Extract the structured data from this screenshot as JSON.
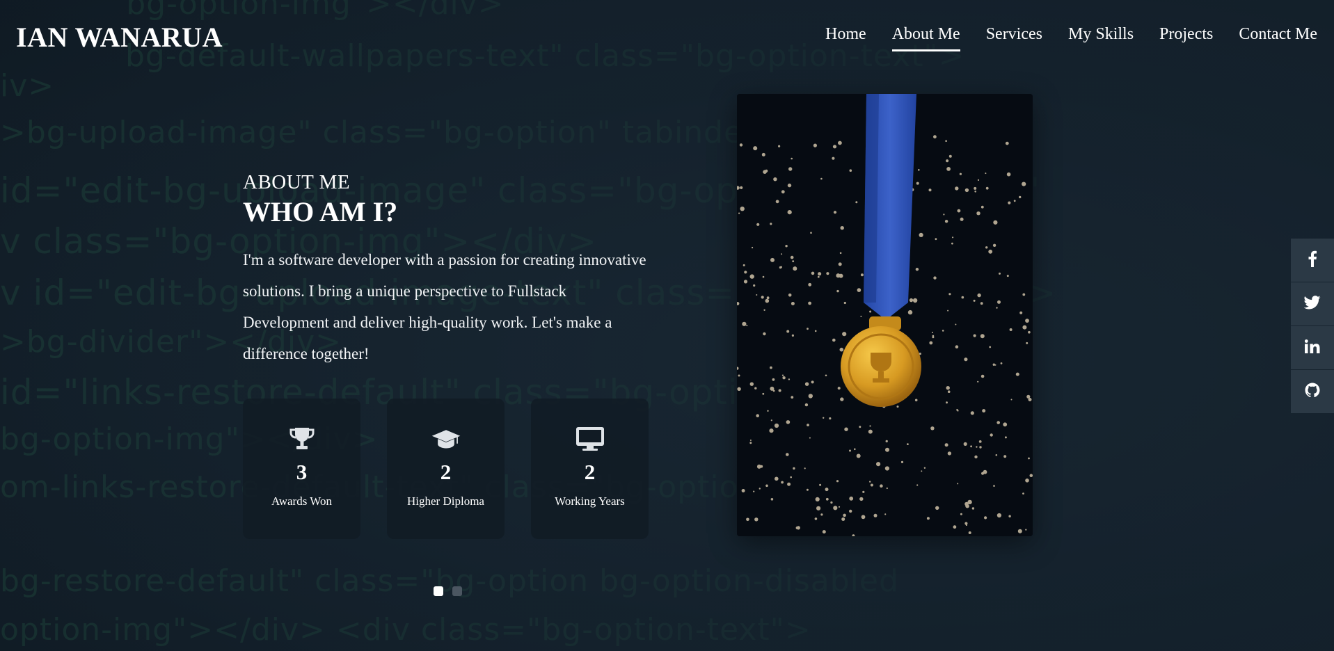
{
  "header": {
    "logo": "IAN WANARUA",
    "nav": [
      {
        "label": "Home",
        "active": false
      },
      {
        "label": "About Me",
        "active": true
      },
      {
        "label": "Services",
        "active": false
      },
      {
        "label": "My Skills",
        "active": false
      },
      {
        "label": "Projects",
        "active": false
      },
      {
        "label": "Contact Me",
        "active": false
      }
    ]
  },
  "about": {
    "eyebrow": "ABOUT ME",
    "title": "WHO AM I?",
    "description": "I'm a software developer with a passion for creating innovative solutions. I bring a unique perspective to Fullstack Development and deliver high-quality work. Let's make a difference together!",
    "stats": [
      {
        "icon": "trophy-icon",
        "value": "3",
        "label": "Awards Won"
      },
      {
        "icon": "graduation-cap-icon",
        "value": "2",
        "label": "Higher Diploma"
      },
      {
        "icon": "monitor-icon",
        "value": "2",
        "label": "Working Years"
      }
    ]
  },
  "carousel": {
    "slides": 2,
    "active_index": 0
  },
  "photo": {
    "description_icon": "medal-icon"
  },
  "social": [
    {
      "icon": "facebook-icon"
    },
    {
      "icon": "twitter-icon"
    },
    {
      "icon": "linkedin-icon"
    },
    {
      "icon": "github-icon"
    }
  ],
  "colors": {
    "background": "#14212c",
    "card": "#111b24",
    "code_green": "#2f7a55",
    "ribbon": "#2f55b8",
    "medal": "#d9a22a",
    "social_bg": "#2e3c48"
  }
}
